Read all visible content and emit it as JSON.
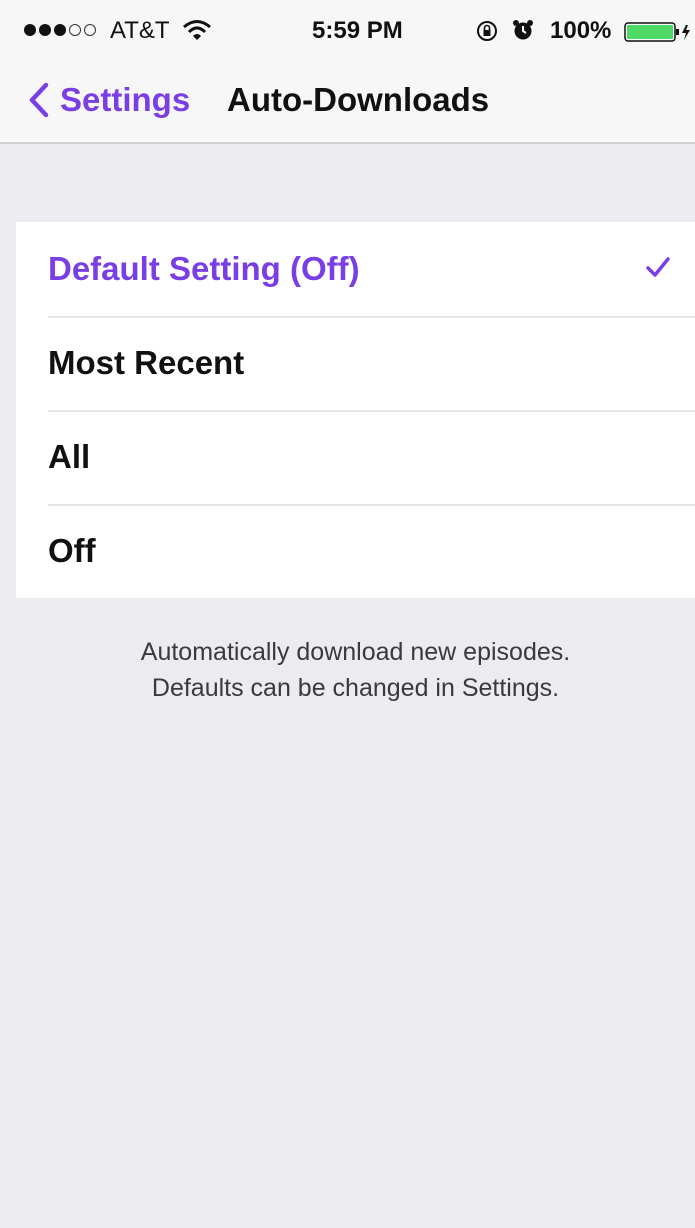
{
  "status_bar": {
    "signal_bars_filled": 3,
    "signal_bars_total": 5,
    "carrier": "AT&T",
    "time": "5:59 PM",
    "battery_percent": "100%",
    "battery_level": 1.0,
    "icons": [
      "signal-dots-icon",
      "wifi-icon",
      "rotation-lock-icon",
      "alarm-icon",
      "battery-icon"
    ]
  },
  "nav": {
    "back_label": "Settings",
    "title": "Auto-Downloads"
  },
  "options": [
    {
      "label": "Default Setting (Off)",
      "selected": true
    },
    {
      "label": "Most Recent",
      "selected": false
    },
    {
      "label": "All",
      "selected": false
    },
    {
      "label": "Off",
      "selected": false
    }
  ],
  "footer": {
    "line1": "Automatically download new episodes.",
    "line2": "Defaults can be changed in Settings."
  },
  "colors": {
    "accent": "#7a3fe4",
    "background": "#ebebf0",
    "battery": "#4cd964"
  }
}
